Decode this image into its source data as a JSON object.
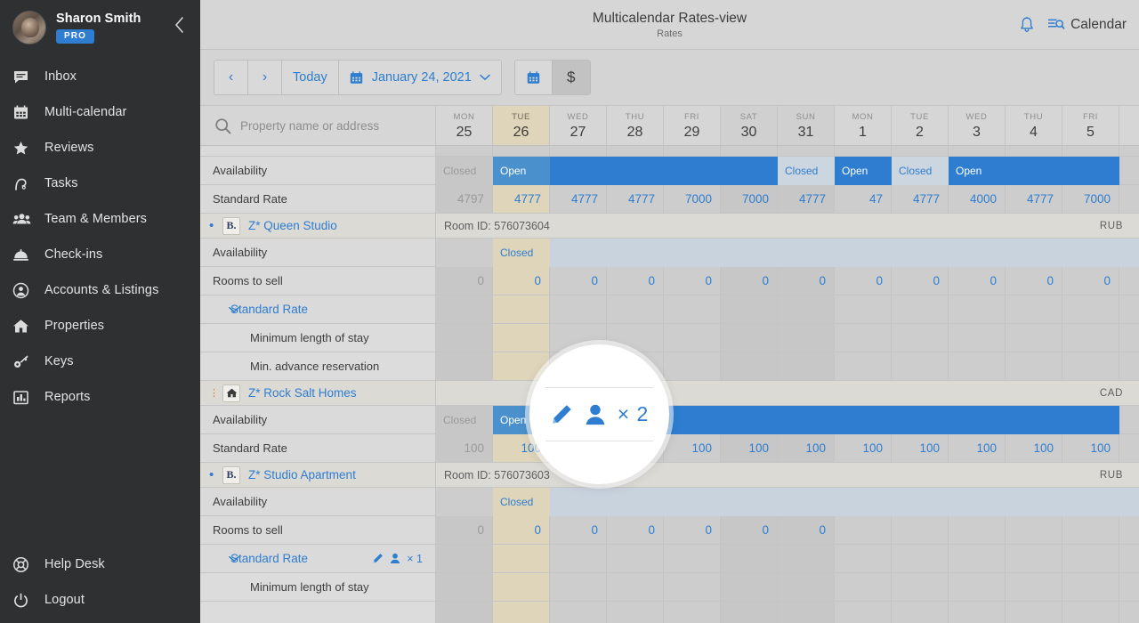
{
  "sidebar": {
    "user": {
      "name": "Sharon Smith",
      "badge": "PRO"
    },
    "collapse_icon": "chevron-left-icon",
    "items": [
      {
        "label": "Inbox",
        "icon": "inbox-message-icon"
      },
      {
        "label": "Multi-calendar",
        "icon": "calendar-icon"
      },
      {
        "label": "Reviews",
        "icon": "star-icon"
      },
      {
        "label": "Tasks",
        "icon": "tasks-icon"
      },
      {
        "label": "Team & Members",
        "icon": "people-group-icon"
      },
      {
        "label": "Check-ins",
        "icon": "bell-desk-icon"
      },
      {
        "label": "Accounts & Listings",
        "icon": "user-circle-icon"
      },
      {
        "label": "Properties",
        "icon": "home-icon"
      },
      {
        "label": "Keys",
        "icon": "key-icon"
      },
      {
        "label": "Reports",
        "icon": "bar-chart-icon"
      }
    ],
    "bottom_items": [
      {
        "label": "Help Desk",
        "icon": "lifebuoy-icon"
      },
      {
        "label": "Logout",
        "icon": "power-icon"
      }
    ]
  },
  "topbar": {
    "title": "Multicalendar Rates-view",
    "subtitle": "Rates",
    "notification_icon": "bell-icon",
    "calendar_view_label": "Calendar",
    "calendar_view_icon": "calendar-search-icon"
  },
  "toolbar": {
    "prev_label": "‹",
    "next_label": "›",
    "today_label": "Today",
    "date_label": "January 24, 2021",
    "date_icon": "calendar-icon",
    "chevron_icon": "chevron-down-icon",
    "view_calendar_icon": "calendar-icon",
    "view_rates_label": "$",
    "active_view": "rates"
  },
  "search": {
    "placeholder": "Property name or address",
    "icon": "search-icon",
    "value": ""
  },
  "days": [
    {
      "dow": "MON",
      "num": "25",
      "weekend": false,
      "past": true,
      "selected": false
    },
    {
      "dow": "TUE",
      "num": "26",
      "weekend": false,
      "past": false,
      "selected": true
    },
    {
      "dow": "WED",
      "num": "27",
      "weekend": false,
      "past": false,
      "selected": false
    },
    {
      "dow": "THU",
      "num": "28",
      "weekend": false,
      "past": false,
      "selected": false
    },
    {
      "dow": "FRI",
      "num": "29",
      "weekend": false,
      "past": false,
      "selected": false
    },
    {
      "dow": "SAT",
      "num": "30",
      "weekend": true,
      "past": false,
      "selected": false
    },
    {
      "dow": "SUN",
      "num": "31",
      "weekend": true,
      "past": false,
      "selected": false
    },
    {
      "dow": "MON",
      "num": "1",
      "weekend": false,
      "past": false,
      "selected": false
    },
    {
      "dow": "TUE",
      "num": "2",
      "weekend": false,
      "past": false,
      "selected": false
    },
    {
      "dow": "WED",
      "num": "3",
      "weekend": false,
      "past": false,
      "selected": false
    },
    {
      "dow": "THU",
      "num": "4",
      "weekend": false,
      "past": false,
      "selected": false
    },
    {
      "dow": "FRI",
      "num": "5",
      "weekend": false,
      "past": false,
      "selected": false
    }
  ],
  "rows": {
    "top_property": {
      "availability_label": "Availability",
      "standard_rate_label": "Standard Rate",
      "availability": [
        {
          "state": "Closed",
          "span": 1,
          "past": true
        },
        {
          "state": "Open",
          "span": 1,
          "lead": true
        },
        {
          "state": "",
          "span": 4
        },
        {
          "state": "Closed",
          "span": 1
        },
        {
          "state": "Open",
          "span": 1
        },
        {
          "state": "Closed",
          "span": 1
        },
        {
          "state": "Open",
          "span": 1
        },
        {
          "state": "",
          "span": 2
        }
      ],
      "rates": [
        "4797",
        "4777",
        "4777",
        "4777",
        "7000",
        "7000",
        "4777",
        "47",
        "4777",
        "4000",
        "4777",
        "7000"
      ]
    },
    "queen_studio": {
      "name": "Z* Queen Studio",
      "logo": "booking-badge",
      "dot_color": "#2f7dd0",
      "room_id": "Room ID: 576073604",
      "currency": "RUB",
      "availability_label": "Availability",
      "availability_first": "Closed",
      "rooms_to_sell_label": "Rooms to sell",
      "rooms_to_sell": [
        "0",
        "0",
        "0",
        "0",
        "0",
        "0",
        "0",
        "0",
        "0",
        "0",
        "0",
        "0"
      ],
      "standard_rate_label": "Standard Rate",
      "occupancy": "× 2",
      "edit_icon": "pencil-icon",
      "person_icon": "person-icon",
      "min_los_label": "Minimum length of stay",
      "min_adv_label": "Min. advance reservation"
    },
    "rock_salt": {
      "name": "Z* Rock Salt Homes",
      "logo": "home-badge",
      "dot_color": "#e8761f",
      "room_id": "",
      "currency": "CAD",
      "availability_label": "Availability",
      "availability": [
        {
          "state": "Closed",
          "span": 1,
          "past": true
        },
        {
          "state": "Open",
          "span": 1,
          "lead": true
        },
        {
          "state": "",
          "span": 10
        }
      ],
      "standard_rate_label": "Standard Rate",
      "rates": [
        "100",
        "100",
        "100",
        "100",
        "100",
        "100",
        "100",
        "100",
        "100",
        "100",
        "100",
        "100"
      ]
    },
    "studio_apartment": {
      "name": "Z* Studio Apartment",
      "logo": "booking-badge",
      "dot_color": "#2f7dd0",
      "room_id": "Room ID: 576073603",
      "currency": "RUB",
      "availability_label": "Availability",
      "availability_first": "Closed",
      "rooms_to_sell_label": "Rooms to sell",
      "rooms_to_sell": [
        "0",
        "0",
        "0",
        "0",
        "0",
        "0",
        "0",
        "",
        "",
        "",
        "",
        ""
      ],
      "standard_rate_label": "Standard Rate",
      "occupancy": "× 1",
      "edit_icon": "pencil-icon",
      "person_icon": "person-icon",
      "min_los_label": "Minimum length of stay"
    }
  },
  "spotlight": {
    "edit_icon": "pencil-icon",
    "person_icon": "person-icon",
    "occupancy": "× 2"
  },
  "colors": {
    "accent": "#2f7dd0",
    "sidebar_bg": "#2f3032",
    "open_blue": "#2f7dd0",
    "selected_day": "#ded5bb",
    "orange_dot": "#e8761f"
  }
}
